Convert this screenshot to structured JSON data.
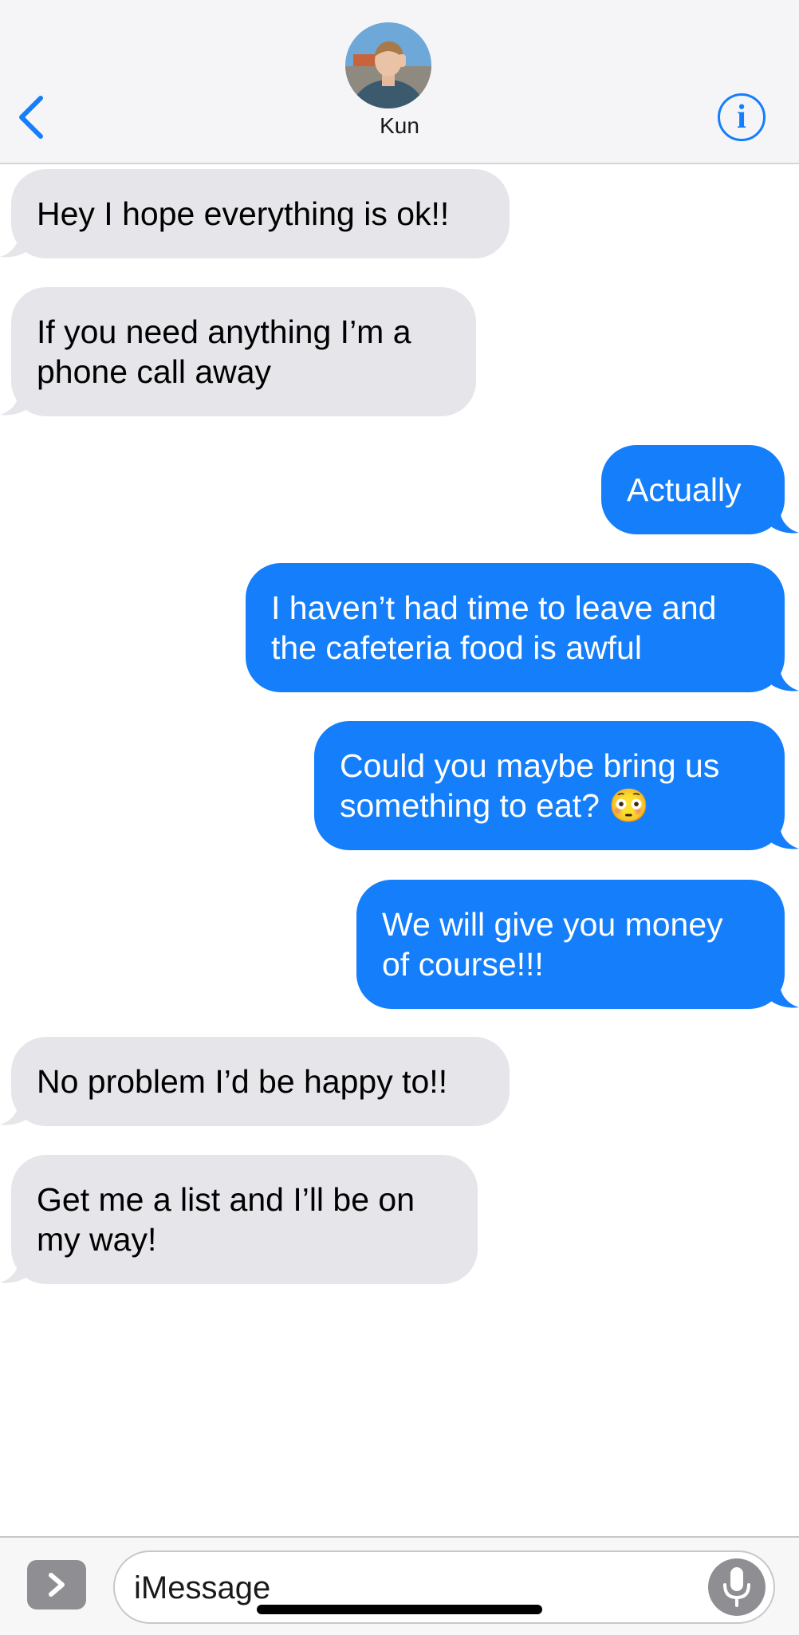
{
  "header": {
    "contact_name": "Kun",
    "back_icon": "chevron-left-icon",
    "info_icon": "info-icon",
    "info_glyph": "i"
  },
  "messages": [
    {
      "direction": "received",
      "text": "Hey I hope everything is ok!!"
    },
    {
      "direction": "received",
      "text": "If you need anything I’m a phone call away"
    },
    {
      "direction": "sent",
      "text": "Actually"
    },
    {
      "direction": "sent",
      "text": "I haven’t had time to leave and the cafeteria food is awful"
    },
    {
      "direction": "sent",
      "text": "Could you maybe bring us something to eat? 😳"
    },
    {
      "direction": "sent",
      "text": "We will give you money of course!!!"
    },
    {
      "direction": "received",
      "text": "No problem I’d be happy to!!"
    },
    {
      "direction": "received",
      "text": "Get me a list and I’ll be on my way!"
    }
  ],
  "composer": {
    "placeholder": "iMessage",
    "value": "",
    "apps_icon": "chevron-right-icon",
    "mic_icon": "microphone-icon"
  },
  "colors": {
    "accent": "#147efb",
    "received_bubble": "#e5e5ea",
    "sent_bubble": "#147efb"
  }
}
